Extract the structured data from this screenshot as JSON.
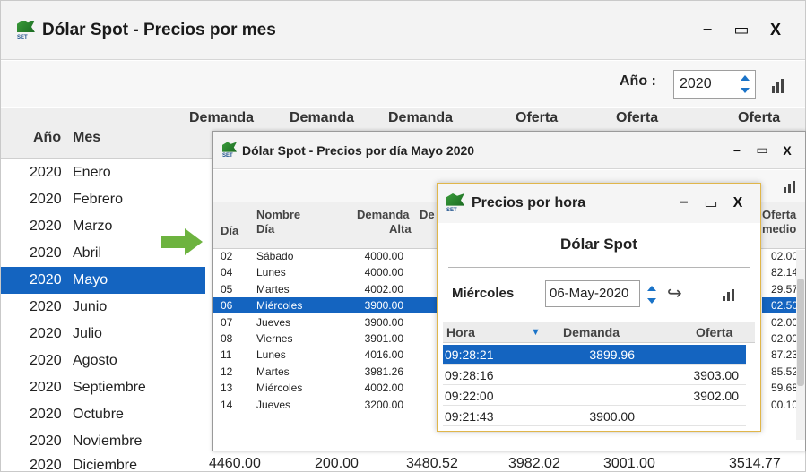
{
  "main": {
    "title": "Dólar Spot - Precios por mes",
    "logo_text": "SET",
    "controls": {
      "minimize": "−",
      "maximize": "▭",
      "close": "X"
    },
    "year_label": "Año :",
    "year_value": "2020",
    "headers": {
      "anio": "Año",
      "mes": "Mes",
      "c1": "Demanda",
      "c2": "Demanda",
      "c3": "Demanda",
      "c4": "Oferta",
      "c5": "Oferta",
      "c6": "Oferta"
    },
    "rows": [
      {
        "year": "2020",
        "month": "Enero"
      },
      {
        "year": "2020",
        "month": "Febrero"
      },
      {
        "year": "2020",
        "month": "Marzo"
      },
      {
        "year": "2020",
        "month": "Abril"
      },
      {
        "year": "2020",
        "month": "Mayo"
      },
      {
        "year": "2020",
        "month": "Junio"
      },
      {
        "year": "2020",
        "month": "Julio"
      },
      {
        "year": "2020",
        "month": "Agosto"
      },
      {
        "year": "2020",
        "month": "Septiembre"
      },
      {
        "year": "2020",
        "month": "Octubre"
      },
      {
        "year": "2020",
        "month": "Noviembre"
      },
      {
        "year": "2020",
        "month": "Diciembre"
      }
    ],
    "selected_row": 4,
    "last_row_values": [
      "4460.00",
      "200.00",
      "3480.52",
      "3982.02",
      "3001.00",
      "3514.77"
    ]
  },
  "day": {
    "title": "Dólar Spot - Precios por día Mayo 2020",
    "headers": {
      "dia": "Día",
      "nombre1": "Nombre",
      "nombre2": "Día",
      "alta1": "Demanda",
      "alta2": "Alta",
      "de": "De",
      "oferta1": "Oferta",
      "oferta2": "medio"
    },
    "rows": [
      {
        "dia": "02",
        "nombre": "Sábado",
        "alta": "4000.00",
        "oferta": "02.00"
      },
      {
        "dia": "04",
        "nombre": "Lunes",
        "alta": "4000.00",
        "oferta": "82.14"
      },
      {
        "dia": "05",
        "nombre": "Martes",
        "alta": "4002.00",
        "oferta": "29.57"
      },
      {
        "dia": "06",
        "nombre": "Miércoles",
        "alta": "3900.00",
        "oferta": "02.50"
      },
      {
        "dia": "07",
        "nombre": "Jueves",
        "alta": "3900.00",
        "oferta": "02.00"
      },
      {
        "dia": "08",
        "nombre": "Viernes",
        "alta": "3901.00",
        "oferta": "02.00"
      },
      {
        "dia": "11",
        "nombre": "Lunes",
        "alta": "4016.00",
        "oferta": "87.23"
      },
      {
        "dia": "12",
        "nombre": "Martes",
        "alta": "3981.26",
        "oferta": "85.52"
      },
      {
        "dia": "13",
        "nombre": "Miércoles",
        "alta": "4002.00",
        "oferta": "59.68"
      },
      {
        "dia": "14",
        "nombre": "Jueves",
        "alta": "3200.00",
        "oferta": "00.10"
      }
    ],
    "selected_row": 3
  },
  "hour": {
    "title": "Precios por hora",
    "subtitle": "Dólar Spot",
    "day_name": "Miércoles",
    "date_value": "06-May-2020",
    "headers": {
      "hora": "Hora",
      "demanda": "Demanda",
      "oferta": "Oferta"
    },
    "rows": [
      {
        "hora": "09:28:21",
        "demanda": "3899.96",
        "oferta": ""
      },
      {
        "hora": "09:28:16",
        "demanda": "",
        "oferta": "3903.00"
      },
      {
        "hora": "09:22:00",
        "demanda": "",
        "oferta": "3902.00"
      },
      {
        "hora": "09:21:43",
        "demanda": "3900.00",
        "oferta": ""
      }
    ],
    "selected_row": 0
  },
  "colors": {
    "selection": "#1464c0",
    "arrow": "#6db33f",
    "accent_border": "#e0b64a"
  }
}
